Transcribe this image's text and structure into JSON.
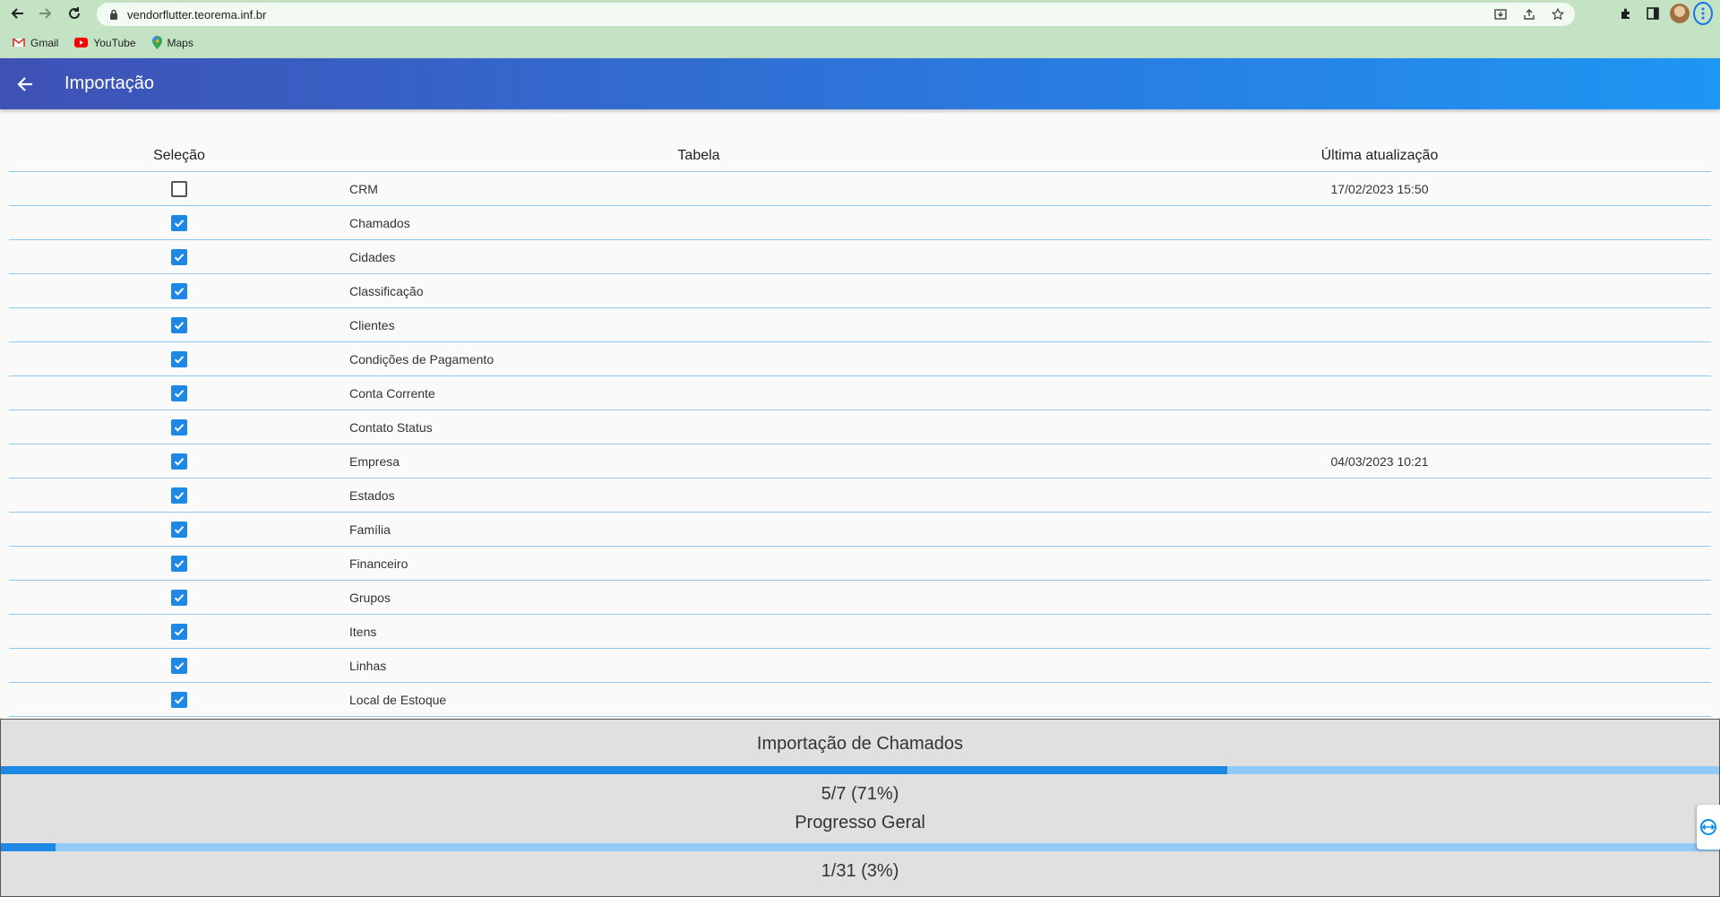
{
  "browser": {
    "url": "vendorflutter.teorema.inf.br",
    "bookmarks": [
      {
        "label": "Gmail",
        "icon": "gmail-icon"
      },
      {
        "label": "YouTube",
        "icon": "youtube-icon"
      },
      {
        "label": "Maps",
        "icon": "maps-icon"
      }
    ]
  },
  "appbar": {
    "title": "Importação",
    "gradient_colors": [
      "#3f51b5",
      "#1e96f3"
    ]
  },
  "table": {
    "headers": {
      "selection": "Seleção",
      "table": "Tabela",
      "last_update": "Última atualização"
    },
    "rows": [
      {
        "checked": false,
        "name": "CRM",
        "updated": "17/02/2023 15:50"
      },
      {
        "checked": true,
        "name": "Chamados",
        "updated": ""
      },
      {
        "checked": true,
        "name": "Cidades",
        "updated": ""
      },
      {
        "checked": true,
        "name": "Classificação",
        "updated": ""
      },
      {
        "checked": true,
        "name": "Clientes",
        "updated": ""
      },
      {
        "checked": true,
        "name": "Condições de Pagamento",
        "updated": ""
      },
      {
        "checked": true,
        "name": "Conta Corrente",
        "updated": ""
      },
      {
        "checked": true,
        "name": "Contato Status",
        "updated": ""
      },
      {
        "checked": true,
        "name": "Empresa",
        "updated": "04/03/2023 10:21"
      },
      {
        "checked": true,
        "name": "Estados",
        "updated": ""
      },
      {
        "checked": true,
        "name": "Família",
        "updated": ""
      },
      {
        "checked": true,
        "name": "Financeiro",
        "updated": ""
      },
      {
        "checked": true,
        "name": "Grupos",
        "updated": ""
      },
      {
        "checked": true,
        "name": "Itens",
        "updated": ""
      },
      {
        "checked": true,
        "name": "Linhas",
        "updated": ""
      },
      {
        "checked": true,
        "name": "Local de Estoque",
        "updated": ""
      }
    ]
  },
  "progress": {
    "current": {
      "title": "Importação de Chamados",
      "text": "5/7 (71%)",
      "fraction": 0.714
    },
    "overall": {
      "title": "Progresso Geral",
      "text": "1/31 (3%)",
      "fraction": 0.032
    },
    "colors": {
      "fill": "#1e88e5",
      "track": "#90caf9"
    }
  }
}
